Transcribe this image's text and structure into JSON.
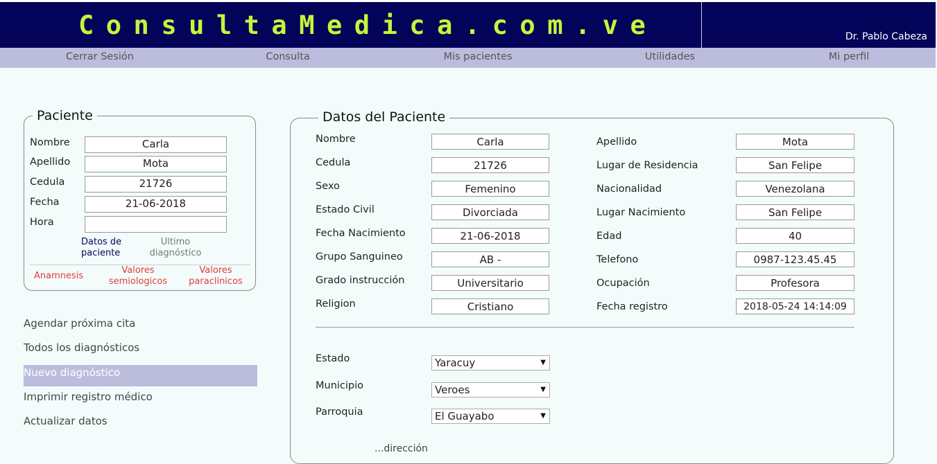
{
  "header": {
    "logo": "ConsultaMedica.com.ve",
    "doctor": "Dr. Pablo Cabeza"
  },
  "nav": [
    "Cerrar Sesión",
    "Consulta",
    "Mis pacientes",
    "Utilidades",
    "Mi perfil"
  ],
  "patient_box": {
    "legend": "Paciente",
    "fields": [
      {
        "label": "Nombre",
        "value": "Carla"
      },
      {
        "label": "Apellido",
        "value": "Mota"
      },
      {
        "label": "Cedula",
        "value": "21726"
      },
      {
        "label": "Fecha",
        "value": "21-06-2018"
      },
      {
        "label": "Hora",
        "value": ""
      }
    ],
    "links_top": [
      "Datos de paciente",
      "Ultimo diagnóstico"
    ],
    "links_bottom": [
      "Anamnesis",
      "Valores semiologicos",
      "Valores paraclinicos"
    ]
  },
  "side_menu": [
    "Agendar próxima cita",
    "Todos los diagnósticos",
    "Nuevo diagnóstico",
    "Imprimir registro médico",
    "Actualizar datos"
  ],
  "datos": {
    "legend": "Datos del Paciente",
    "left": [
      {
        "label": "Nombre",
        "value": "Carla"
      },
      {
        "label": "Cedula",
        "value": "21726"
      },
      {
        "label": "Sexo",
        "value": "Femenino"
      },
      {
        "label": "Estado Civil",
        "value": "Divorciada"
      },
      {
        "label": "Fecha Nacimiento",
        "value": "21-06-2018"
      },
      {
        "label": "Grupo Sanguineo",
        "value": "AB -"
      },
      {
        "label": "Grado instrucción",
        "value": "Universitario"
      },
      {
        "label": "Religion",
        "value": "Cristiano"
      }
    ],
    "right": [
      {
        "label": "Apellido",
        "value": "Mota"
      },
      {
        "label": "Lugar de Residencia",
        "value": "San Felipe"
      },
      {
        "label": "Nacionalidad",
        "value": "Venezolana"
      },
      {
        "label": "Lugar Nacimiento",
        "value": "San Felipe"
      },
      {
        "label": "Edad",
        "value": "40"
      },
      {
        "label": "Telefono",
        "value": "0987-123.45.45"
      },
      {
        "label": "Ocupación",
        "value": "Profesora"
      },
      {
        "label": "Fecha registro",
        "value": "2018-05-24 14:14:09"
      }
    ],
    "location": [
      {
        "label": "Estado",
        "value": "Yaracuy"
      },
      {
        "label": "Municipio",
        "value": "Veroes"
      },
      {
        "label": "Parroquia",
        "value": "El Guayabo"
      }
    ],
    "cut_text": "...dirección"
  },
  "colors": {
    "header_bg": "#03035a",
    "logo": "#c6f53a",
    "nav_bg": "#bcbddc",
    "page_bg": "#f3fcfb",
    "red_link": "#e03c3c",
    "blue_link": "#03035a"
  }
}
